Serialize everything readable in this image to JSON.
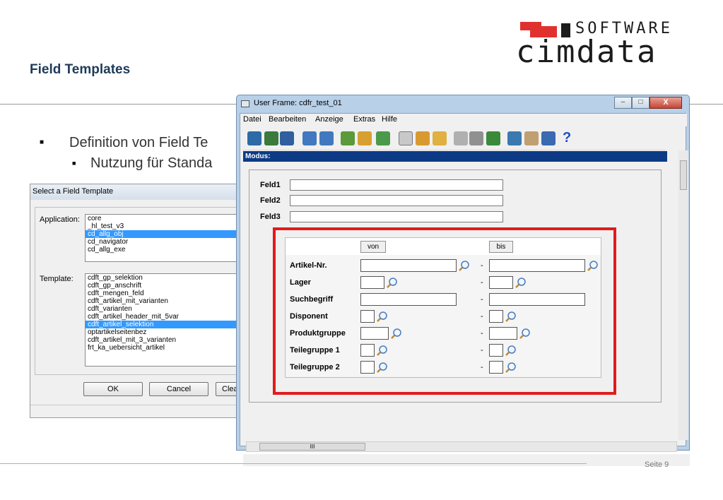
{
  "slide": {
    "title": "Field Templates",
    "page_number": "Seite 9",
    "bullets": [
      {
        "text": "Definition von Field Te"
      },
      {
        "text": "Nutzung für Standa"
      }
    ]
  },
  "logo": {
    "word_top": "SOFTWARE",
    "word_main": "cimdata"
  },
  "select_dialog": {
    "title": "Select a Field Template",
    "application_label": "Application:",
    "applications": [
      "core",
      "_hl_test_v3",
      "cd_allg_obj",
      "cd_navigator",
      "cd_allg_exe"
    ],
    "application_selected": "cd_allg_obj",
    "template_label": "Template:",
    "templates": [
      "cdft_gp_selektion",
      "cdft_gp_anschrift",
      "cdft_mengen_feld",
      "cdft_artikel_mit_varianten",
      "cdft_varianten",
      "cdft_artikel_header_mit_5var",
      "cdft_artikel_selektion",
      "optartikelseitenbez",
      "cdft_artikel_mit_3_varianten",
      "frt_ka_uebersicht_artikel"
    ],
    "template_selected": "cdft_artikel_selektion",
    "ok_label": "OK",
    "cancel_label": "Cancel",
    "clear_label": "Clear"
  },
  "user_frame": {
    "title": "User Frame: cdfr_test_01",
    "minimize": "–",
    "maximize": "□",
    "close": "X",
    "menu": [
      "Datei",
      "Bearbeiten",
      "Anzeige",
      "Extras",
      "Hilfe"
    ],
    "modus_label": "Modus:",
    "fields": [
      {
        "label": "Feld1",
        "value": ""
      },
      {
        "label": "Feld2",
        "value": ""
      },
      {
        "label": "Feld3",
        "value": ""
      }
    ],
    "template": {
      "von_label": "von",
      "bis_label": "bis",
      "dash": "-",
      "rows": [
        {
          "label": "Artikel-Nr."
        },
        {
          "label": "Lager"
        },
        {
          "label": "Suchbegriff"
        },
        {
          "label": "Disponent"
        },
        {
          "label": "Produktgruppe"
        },
        {
          "label": "Teilegruppe 1"
        },
        {
          "label": "Teilegruppe 2"
        }
      ]
    },
    "scroll_thumb_label": "III",
    "help_glyph": "?"
  },
  "toolbar_icons": [
    "exit-icon",
    "save-check-icon",
    "save-icon",
    "download-icon",
    "upload-icon",
    "refresh-icon",
    "edit-icon",
    "reload-icon",
    "mail-icon",
    "folder-edit-icon",
    "folder-icon",
    "note-icon",
    "print-icon",
    "list-icon",
    "copy-icon",
    "tag-icon",
    "table-icon",
    "help-icon"
  ],
  "colors": {
    "title": "#1f3a5a",
    "selection": "#3399ff",
    "modus_bar": "#0c3a84",
    "highlight": "#e21b1b",
    "logo_red": "#e1312f"
  }
}
